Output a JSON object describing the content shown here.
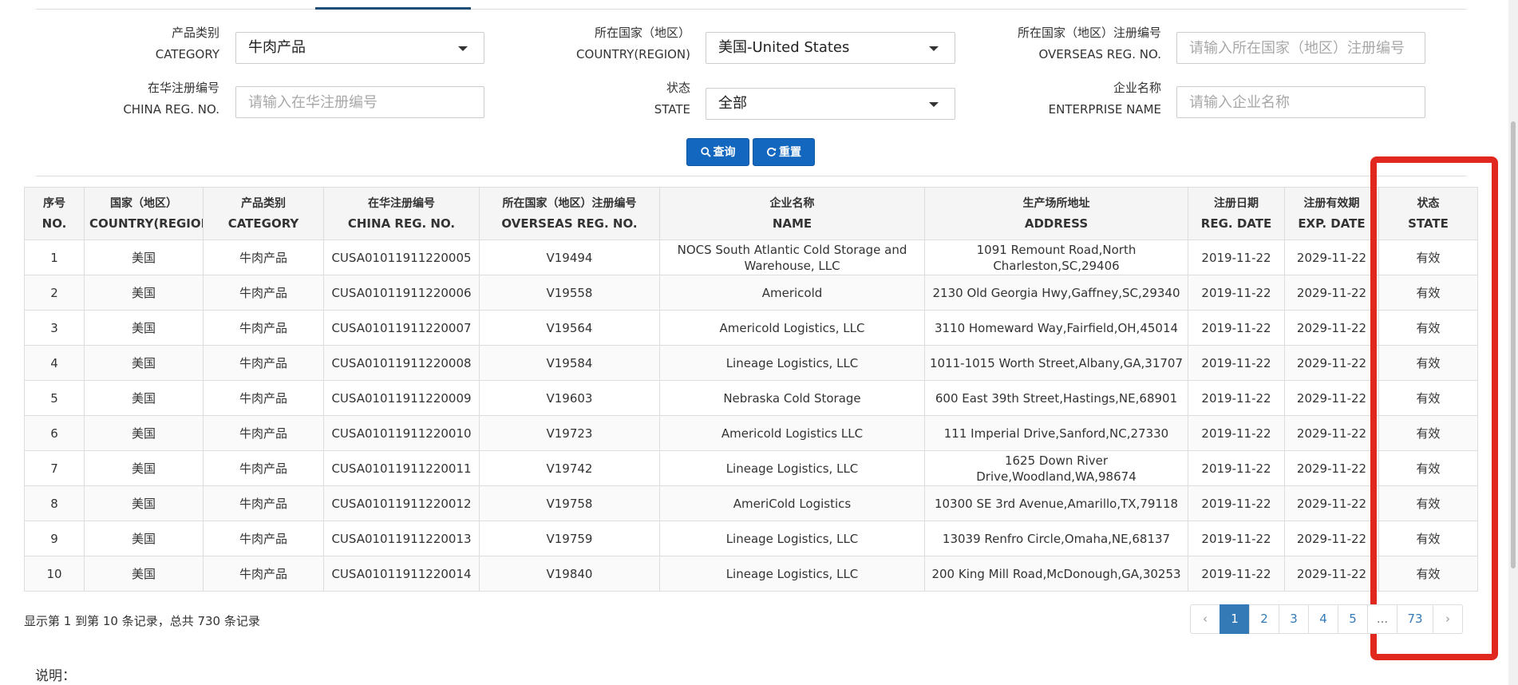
{
  "filters": {
    "category": {
      "label_zh": "产品类别",
      "label_en": "CATEGORY",
      "value": "牛肉产品"
    },
    "country": {
      "label_zh": "所在国家（地区）",
      "label_en": "COUNTRY(REGION)",
      "value": "美国-United States"
    },
    "overseas_reg": {
      "label_zh": "所在国家（地区）注册编号",
      "label_en": "OVERSEAS REG. NO.",
      "placeholder": "请输入所在国家（地区）注册编号"
    },
    "china_reg": {
      "label_zh": "在华注册编号",
      "label_en": "CHINA REG. NO.",
      "placeholder": "请输入在华注册编号"
    },
    "state": {
      "label_zh": "状态",
      "label_en": "STATE",
      "value": "全部"
    },
    "enterprise": {
      "label_zh": "企业名称",
      "label_en": "ENTERPRISE NAME",
      "placeholder": "请输入企业名称"
    }
  },
  "buttons": {
    "query": "查询",
    "reset": "重置"
  },
  "table": {
    "headers": [
      {
        "zh": "序号",
        "en": "NO."
      },
      {
        "zh": "国家（地区）",
        "en": "COUNTRY(REGION)"
      },
      {
        "zh": "产品类别",
        "en": "CATEGORY"
      },
      {
        "zh": "在华注册编号",
        "en": "CHINA REG. NO."
      },
      {
        "zh": "所在国家（地区）注册编号",
        "en": "OVERSEAS REG. NO."
      },
      {
        "zh": "企业名称",
        "en": "NAME"
      },
      {
        "zh": "生产场所地址",
        "en": "ADDRESS"
      },
      {
        "zh": "注册日期",
        "en": "REG. DATE"
      },
      {
        "zh": "注册有效期",
        "en": "EXP. DATE"
      },
      {
        "zh": "状态",
        "en": "STATE"
      }
    ],
    "rows": [
      [
        "1",
        "美国",
        "牛肉产品",
        "CUSA01011911220005",
        "V19494",
        "NOCS South Atlantic Cold Storage and Warehouse, LLC",
        "1091 Remount Road,North Charleston,SC,29406",
        "2019-11-22",
        "2029-11-22",
        "有效"
      ],
      [
        "2",
        "美国",
        "牛肉产品",
        "CUSA01011911220006",
        "V19558",
        "Americold",
        "2130 Old Georgia Hwy,Gaffney,SC,29340",
        "2019-11-22",
        "2029-11-22",
        "有效"
      ],
      [
        "3",
        "美国",
        "牛肉产品",
        "CUSA01011911220007",
        "V19564",
        "Americold Logistics, LLC",
        "3110 Homeward Way,Fairfield,OH,45014",
        "2019-11-22",
        "2029-11-22",
        "有效"
      ],
      [
        "4",
        "美国",
        "牛肉产品",
        "CUSA01011911220008",
        "V19584",
        "Lineage Logistics, LLC",
        "1011-1015 Worth Street,Albany,GA,31707",
        "2019-11-22",
        "2029-11-22",
        "有效"
      ],
      [
        "5",
        "美国",
        "牛肉产品",
        "CUSA01011911220009",
        "V19603",
        "Nebraska Cold Storage",
        "600 East 39th Street,Hastings,NE,68901",
        "2019-11-22",
        "2029-11-22",
        "有效"
      ],
      [
        "6",
        "美国",
        "牛肉产品",
        "CUSA01011911220010",
        "V19723",
        "Americold Logistics LLC",
        "111 Imperial Drive,Sanford,NC,27330",
        "2019-11-22",
        "2029-11-22",
        "有效"
      ],
      [
        "7",
        "美国",
        "牛肉产品",
        "CUSA01011911220011",
        "V19742",
        "Lineage Logistics, LLC",
        "1625 Down River Drive,Woodland,WA,98674",
        "2019-11-22",
        "2029-11-22",
        "有效"
      ],
      [
        "8",
        "美国",
        "牛肉产品",
        "CUSA01011911220012",
        "V19758",
        "AmeriCold Logistics",
        "10300 SE 3rd Avenue,Amarillo,TX,79118",
        "2019-11-22",
        "2029-11-22",
        "有效"
      ],
      [
        "9",
        "美国",
        "牛肉产品",
        "CUSA01011911220013",
        "V19759",
        "Lineage Logistics, LLC",
        "13039 Renfro Circle,Omaha,NE,68137",
        "2019-11-22",
        "2029-11-22",
        "有效"
      ],
      [
        "10",
        "美国",
        "牛肉产品",
        "CUSA01011911220014",
        "V19840",
        "Lineage Logistics, LLC",
        "200 King Mill Road,McDonough,GA,30253",
        "2019-11-22",
        "2029-11-22",
        "有效"
      ]
    ]
  },
  "footer": {
    "summary": "显示第 1 到第 10 条记录，总共 730 条记录"
  },
  "pagination": {
    "prev": "‹",
    "pages": [
      "1",
      "2",
      "3",
      "4",
      "5"
    ],
    "ellipsis": "...",
    "last": "73",
    "next": "›",
    "active": "1"
  },
  "notes": {
    "title": "说明："
  },
  "colors": {
    "primary_button": "#1367be",
    "pager_active": "#337ab7",
    "highlight": "#e0281e"
  }
}
